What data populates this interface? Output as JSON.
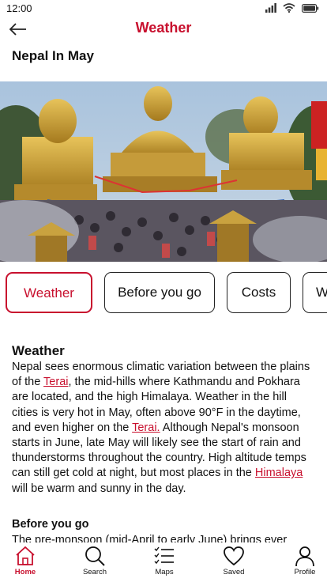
{
  "status": {
    "time": "12:00"
  },
  "header": {
    "title": "Weather"
  },
  "page": {
    "title": "Nepal In May"
  },
  "tabs": [
    {
      "label": "Weather",
      "active": true
    },
    {
      "label": "Before you go",
      "active": false
    },
    {
      "label": "Costs",
      "active": false
    },
    {
      "label": "W",
      "active": false
    }
  ],
  "weather": {
    "heading": "Weather",
    "p1": "Nepal sees enormous climatic variation between the plains of the ",
    "link1": "Terai",
    "p2": ", the mid-hills where Kathmandu and Pokhara are located, and the high Himalaya. Weather in the hill cities is very hot in May, often above 90°F in the daytime, and even higher on the ",
    "link2": "Terai.",
    "p3": " Although Nepal's monsoon starts in June, late May will likely see the start of rain and thunderstorms throughout the country. High altitude temps can still get cold at night, but most places in the ",
    "link3": "Himalaya ",
    "p4": " will be warm and sunny in the day."
  },
  "before_you_go": {
    "heading": "Before you go",
    "text": "The pre-monsoon (mid-April to early June) brings ever"
  },
  "bottom_nav": [
    {
      "label": "Home",
      "icon": "home-icon",
      "active": true
    },
    {
      "label": "Search",
      "icon": "search-icon",
      "active": false
    },
    {
      "label": "Maps",
      "icon": "maps-list-icon",
      "active": false
    },
    {
      "label": "Saved",
      "icon": "heart-icon",
      "active": false
    },
    {
      "label": "Profile",
      "icon": "profile-icon",
      "active": false
    }
  ],
  "colors": {
    "accent": "#c8102e"
  }
}
